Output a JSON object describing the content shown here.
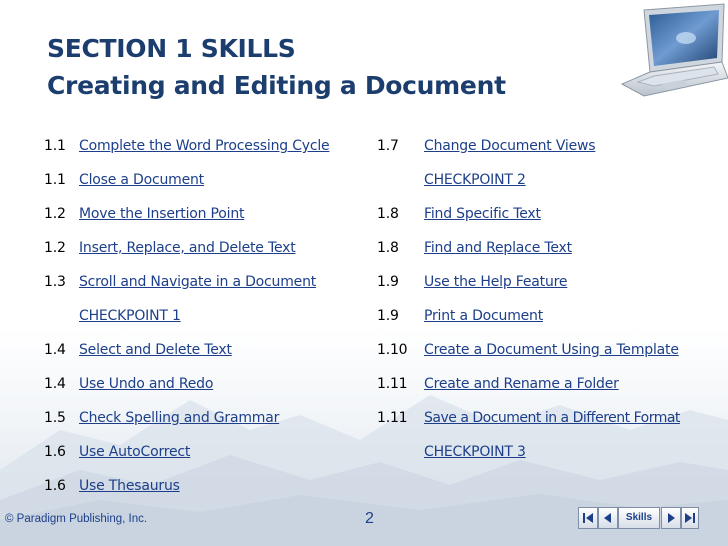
{
  "title": {
    "line1": "SECTION 1 SKILLS",
    "line2": "Creating and Editing a Document"
  },
  "left_column": [
    {
      "num": "1.1",
      "label": "Complete the Word Processing Cycle"
    },
    {
      "num": "1.1",
      "label": "Close a Document"
    },
    {
      "num": "1.2",
      "label": "Move the Insertion Point"
    },
    {
      "num": "1.2",
      "label": "Insert, Replace, and Delete Text"
    },
    {
      "num": "1.3",
      "label": "Scroll and Navigate in a Document"
    },
    {
      "num": "",
      "label": "CHECKPOINT 1"
    },
    {
      "num": "1.4",
      "label": "Select and Delete Text"
    },
    {
      "num": "1.4",
      "label": "Use Undo and Redo"
    },
    {
      "num": "1.5",
      "label": "Check Spelling and Grammar"
    },
    {
      "num": "1.6",
      "label": "Use AutoCorrect"
    },
    {
      "num": "1.6",
      "label": "Use Thesaurus"
    }
  ],
  "right_column": [
    {
      "num": "1.7",
      "label": "Change Document Views"
    },
    {
      "num": "",
      "label": "CHECKPOINT 2"
    },
    {
      "num": "1.8",
      "label": "Find Specific Text"
    },
    {
      "num": "1.8",
      "label": "Find and Replace Text"
    },
    {
      "num": "1.9",
      "label": "Use the Help Feature"
    },
    {
      "num": "1.9",
      "label": "Print a Document"
    },
    {
      "num": "1.10",
      "label": "Create a Document Using a Template"
    },
    {
      "num": "1.11",
      "label": "Create and Rename a Folder"
    },
    {
      "num": "1.11",
      "label": "Save a Document in a Different Format"
    },
    {
      "num": "",
      "label": "CHECKPOINT 3"
    }
  ],
  "footer": {
    "copyright": "© Paradigm Publishing, Inc.",
    "page_number": "2",
    "skills_button": "Skills"
  },
  "colors": {
    "title": "#1c3e6e",
    "link": "#1d3f8a"
  },
  "icons": [
    "laptop-icon",
    "first-slide-icon",
    "prev-slide-icon",
    "next-slide-icon",
    "last-slide-icon"
  ]
}
